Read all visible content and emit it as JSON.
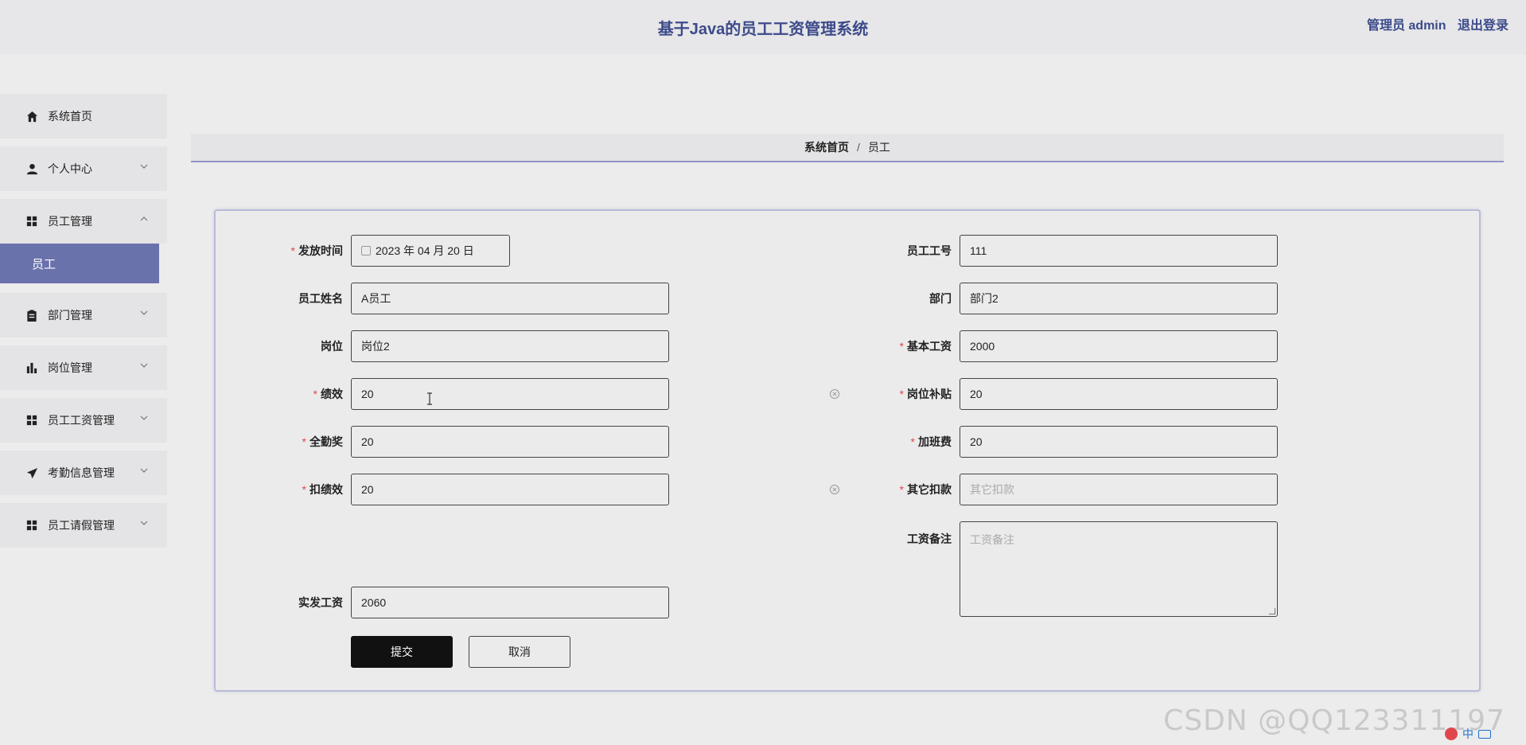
{
  "header": {
    "title": "基于Java的员工工资管理系统",
    "user_label": "管理员 admin",
    "logout": "退出登录"
  },
  "sidebar": {
    "items": [
      {
        "label": "系统首页",
        "icon": "home-icon",
        "expanded": false
      },
      {
        "label": "个人中心",
        "icon": "user-icon",
        "expanded": false
      },
      {
        "label": "员工管理",
        "icon": "grid-icon",
        "expanded": true
      },
      {
        "label": "部门管理",
        "icon": "clipboard-icon",
        "expanded": false
      },
      {
        "label": "岗位管理",
        "icon": "bar-chart-icon",
        "expanded": false
      },
      {
        "label": "员工工资管理",
        "icon": "grid-icon",
        "expanded": false
      },
      {
        "label": "考勤信息管理",
        "icon": "send-icon",
        "expanded": false
      },
      {
        "label": "员工请假管理",
        "icon": "grid-icon",
        "expanded": false
      }
    ],
    "submenu_active": "员工"
  },
  "breadcrumb": {
    "home": "系统首页",
    "separator": "/",
    "current": "员工"
  },
  "form": {
    "issue_date": {
      "label": "发放时间",
      "value": "2023 年 04 月 20 日",
      "required": true
    },
    "employee_id": {
      "label": "员工工号",
      "value": "111",
      "required": false
    },
    "employee_name": {
      "label": "员工姓名",
      "value": "A员工",
      "required": false
    },
    "department": {
      "label": "部门",
      "value": "部门2",
      "required": false
    },
    "position": {
      "label": "岗位",
      "value": "岗位2",
      "required": false
    },
    "base_salary": {
      "label": "基本工资",
      "value": "2000",
      "required": true
    },
    "performance": {
      "label": "绩效",
      "value": "20",
      "required": true
    },
    "position_allowance": {
      "label": "岗位补贴",
      "value": "20",
      "required": true
    },
    "attendance_bonus": {
      "label": "全勤奖",
      "value": "20",
      "required": true
    },
    "overtime_pay": {
      "label": "加班费",
      "value": "20",
      "required": true
    },
    "performance_deduction": {
      "label": "扣绩效",
      "value": "20",
      "required": true
    },
    "other_deduction": {
      "label": "其它扣款",
      "value": "",
      "placeholder": "其它扣款",
      "required": true
    },
    "salary_note": {
      "label": "工资备注",
      "value": "",
      "placeholder": "工资备注",
      "required": false
    },
    "actual_salary": {
      "label": "实发工资",
      "value": "2060",
      "required": false
    }
  },
  "buttons": {
    "submit": "提交",
    "cancel": "取消"
  },
  "watermark": "CSDN @QQ123311197",
  "ime": "中",
  "colors": {
    "accent": "#3c4b8a",
    "active_menu": "#6a72ac",
    "required": "#e0474c",
    "primary_button": "#111111"
  }
}
